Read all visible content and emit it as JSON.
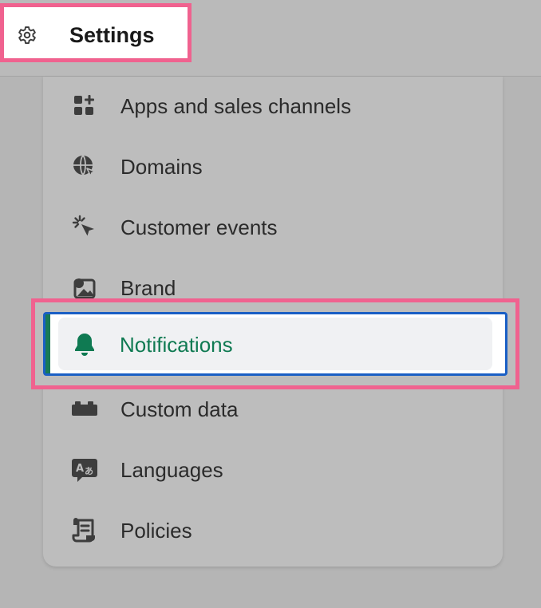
{
  "header": {
    "title": "Settings",
    "icon": "gear-icon"
  },
  "menu": {
    "items": [
      {
        "label": "Apps and sales channels",
        "icon": "apps-icon"
      },
      {
        "label": "Domains",
        "icon": "globe-icon"
      },
      {
        "label": "Customer events",
        "icon": "cursor-click-icon"
      },
      {
        "label": "Brand",
        "icon": "brand-image-icon"
      },
      {
        "label": "Notifications",
        "icon": "bell-icon",
        "selected": true
      },
      {
        "label": "Custom data",
        "icon": "blocks-icon"
      },
      {
        "label": "Languages",
        "icon": "language-icon"
      },
      {
        "label": "Policies",
        "icon": "policy-document-icon"
      }
    ]
  },
  "colors": {
    "highlight": "#f0628f",
    "focus_ring": "#1a5fc5",
    "selected_text": "#0f7a52",
    "selected_accent": "#1a7a56"
  }
}
